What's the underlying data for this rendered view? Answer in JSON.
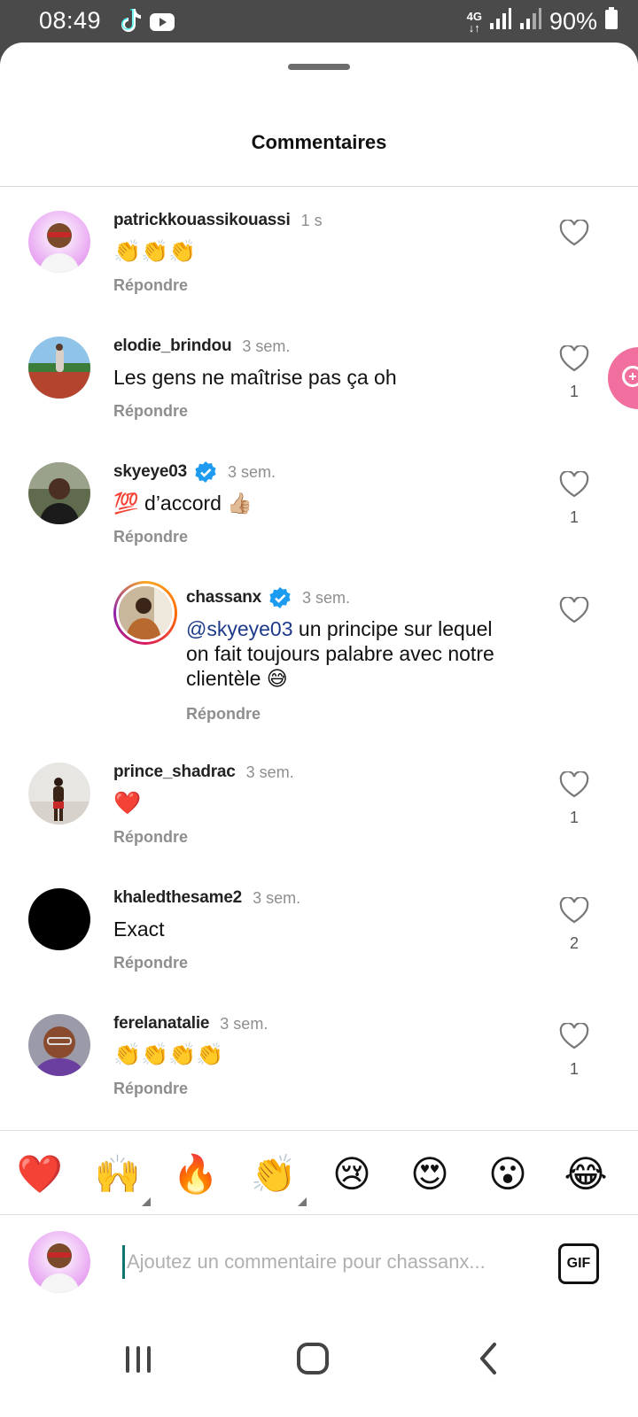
{
  "status_bar": {
    "time": "08:49",
    "network": "4G",
    "battery": "90%",
    "app_icons": [
      "tiktok-icon",
      "youtube-icon"
    ]
  },
  "sheet": {
    "title": "Commentaires"
  },
  "reply_label": "Répondre",
  "comments": [
    {
      "username": "patrickkouassikouassi",
      "timestamp": "1 s",
      "text": "👏👏👏",
      "likes": "",
      "verified": false,
      "emoji_only": true
    },
    {
      "username": "elodie_brindou",
      "timestamp": "3 sem.",
      "text": "Les gens ne maîtrise pas ça oh",
      "likes": "1",
      "verified": false
    },
    {
      "username": "skyeye03",
      "timestamp": "3 sem.",
      "text": "💯 d’accord 👍🏼",
      "likes": "1",
      "verified": true
    },
    {
      "username": "chassanx",
      "timestamp": "3 sem.",
      "mention": "@skyeye03",
      "text_line_1": " un principe sur lequel",
      "text_line_2": "on fait toujours palabre avec notre",
      "text_line_3": "clientèle 😅",
      "likes": "",
      "verified": true,
      "is_reply": true
    },
    {
      "username": "prince_shadrac",
      "timestamp": "3 sem.",
      "text": "❤️",
      "likes": "1",
      "verified": false,
      "emoji_only": true
    },
    {
      "username": "khaledthesame2",
      "timestamp": "3 sem.",
      "text": "Exact",
      "likes": "2",
      "verified": false
    },
    {
      "username": "ferelanatalie",
      "timestamp": "3 sem.",
      "text": "👏👏👏👏",
      "likes": "1",
      "verified": false,
      "emoji_only": true
    }
  ],
  "quick_reactions": [
    "❤️",
    "🙌",
    "🔥",
    "👏",
    "😢",
    "😍",
    "😮",
    "😂"
  ],
  "composer": {
    "placeholder": "Ajoutez un commentaire pour chassanx...",
    "gif_label": "GIF"
  },
  "colors": {
    "verified_blue": "#1d9bf0",
    "mention": "#1e3a8a",
    "fab_pink": "#f06f9e",
    "status_bar_bg": "#4a4a4a"
  }
}
